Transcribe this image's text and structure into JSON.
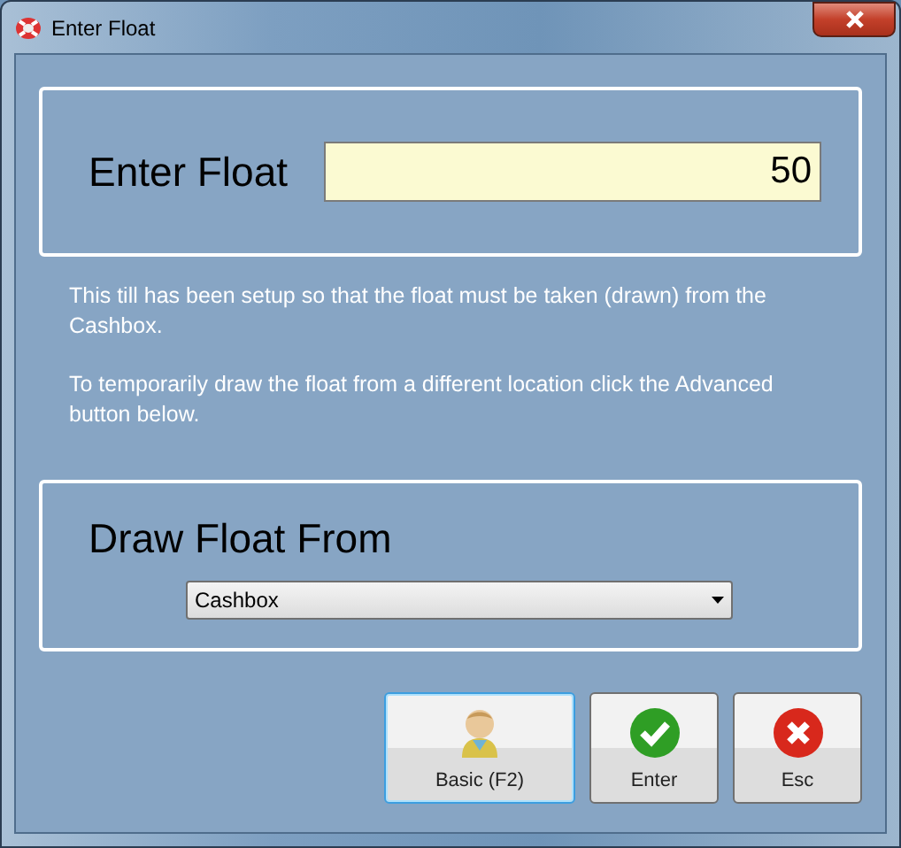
{
  "window": {
    "title": "Enter Float"
  },
  "float_panel": {
    "label": "Enter Float",
    "value": "50"
  },
  "info": [
    "This till has been setup so that the float must be taken (drawn) from the Cashbox.",
    "To temporarily draw the float from a different location click the Advanced button below."
  ],
  "draw_panel": {
    "label": "Draw Float From",
    "selected_value": "Cashbox"
  },
  "buttons": [
    {
      "kind": "person",
      "label": "Basic (F2)",
      "focused": true
    },
    {
      "kind": "check",
      "label": "Enter",
      "focused": false
    },
    {
      "kind": "cross",
      "label": "Esc",
      "focused": false
    }
  ]
}
